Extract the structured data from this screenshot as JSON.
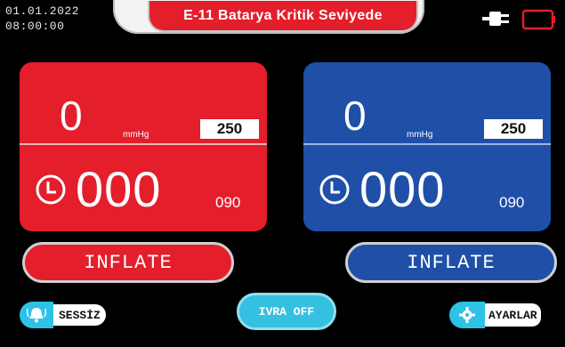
{
  "status_bar": {
    "date": "01.01.2022",
    "time": "08:00:00",
    "icons": [
      "plug-icon",
      "battery-icon"
    ]
  },
  "alarm": {
    "text": "E-11 Batarya Kritik Seviyede",
    "color": "#e41e2b"
  },
  "channels": [
    {
      "color": "#e41e2b",
      "pressure": "0",
      "unit": "mmHg",
      "set_pressure": "250",
      "time": "000",
      "set_time": "090",
      "inflate_label": "INFLATE"
    },
    {
      "color": "#1f4fa7",
      "pressure": "0",
      "unit": "mmHg",
      "set_pressure": "250",
      "time": "000",
      "set_time": "090",
      "inflate_label": "INFLATE"
    }
  ],
  "controls": {
    "mute_label": "SESSİZ",
    "ivra_label": "IVRA OFF",
    "settings_label": "AYARLAR",
    "accent": "#2ec2e6"
  }
}
